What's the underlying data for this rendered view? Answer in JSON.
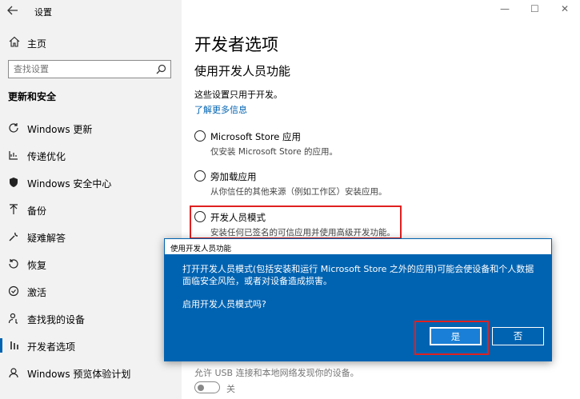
{
  "window": {
    "title": "设置",
    "controls": [
      "—",
      "☐",
      "✕"
    ]
  },
  "sidebar": {
    "home": "主页",
    "search_placeholder": "查找设置",
    "section": "更新和安全",
    "items": [
      {
        "label": "Windows 更新",
        "icon": "refresh-icon"
      },
      {
        "label": "传递优化",
        "icon": "delivery-icon"
      },
      {
        "label": "Windows 安全中心",
        "icon": "shield-icon"
      },
      {
        "label": "备份",
        "icon": "backup-icon"
      },
      {
        "label": "疑难解答",
        "icon": "wrench-icon"
      },
      {
        "label": "恢复",
        "icon": "history-icon"
      },
      {
        "label": "激活",
        "icon": "check-circle-icon"
      },
      {
        "label": "查找我的设备",
        "icon": "person-pin-icon"
      },
      {
        "label": "开发者选项",
        "icon": "dev-bars-icon",
        "active": true
      },
      {
        "label": "Windows 预览体验计划",
        "icon": "insider-icon"
      }
    ]
  },
  "main": {
    "title": "开发者选项",
    "subtitle": "使用开发人员功能",
    "description": "这些设置只用于开发。",
    "link": "了解更多信息",
    "options": [
      {
        "title": "Microsoft Store 应用",
        "desc": "仅安装 Microsoft Store 的应用。"
      },
      {
        "title": "旁加载应用",
        "desc": "从你信任的其他来源（例如工作区）安装应用。"
      },
      {
        "title": "开发人员模式",
        "desc": "安装任何已签名的可信应用并使用高级开发功能。"
      }
    ],
    "bottom_text": "允许 USB 连接和本地网络发现你的设备。",
    "toggle_label": "关"
  },
  "dialog": {
    "title": "使用开发人员功能",
    "body": "打开开发人员模式(包括安装和运行 Microsoft Store 之外的应用)可能会使设备和个人数据面临安全风险，或者对设备造成损害。",
    "question": "启用开发人员模式吗?",
    "yes": "是",
    "no": "否"
  },
  "colors": {
    "accent": "#0063b1",
    "highlight": "#e02020",
    "sidebar_bg": "#f2f2f2"
  }
}
